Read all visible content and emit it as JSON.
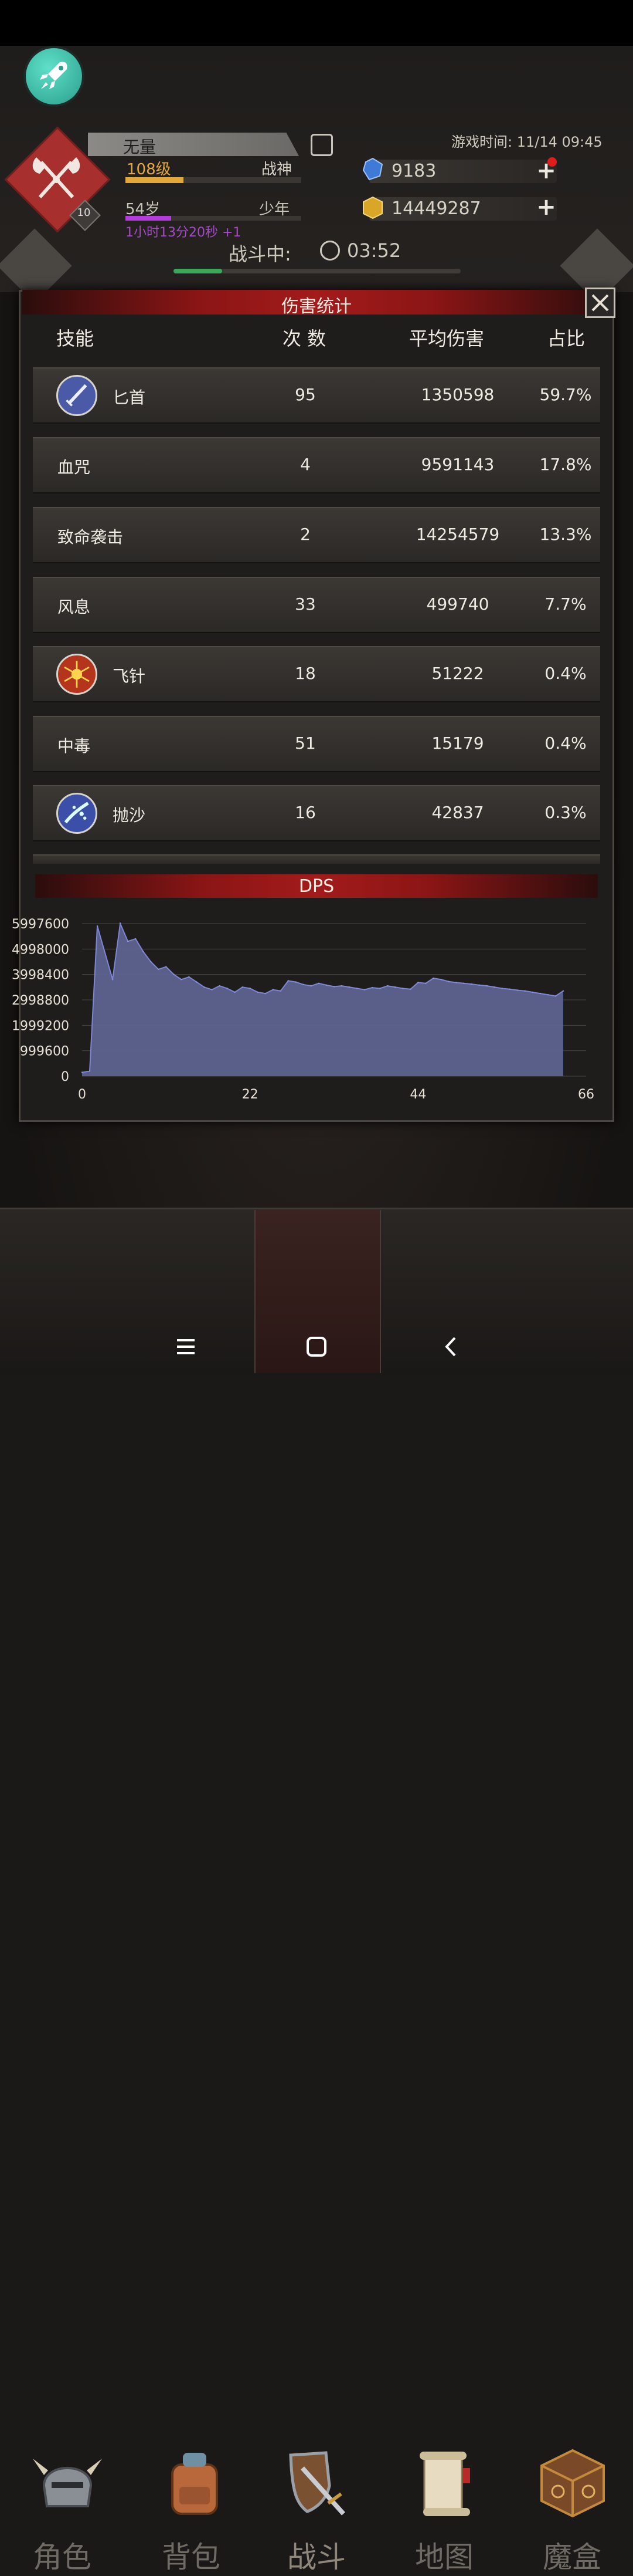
{
  "header": {
    "player_name": "无量",
    "level": "108级",
    "title": "战神",
    "age": "54岁",
    "stage": "少年",
    "time_bonus": "1小时13分20秒 +1",
    "rank_badge": "10",
    "game_time": "游戏时间: 11/14 09:45",
    "gems": "9183",
    "gold": "14449287",
    "level_progress": 0.33,
    "age_progress": 0.26
  },
  "battle": {
    "label": "战斗中:",
    "timer": "03:52",
    "progress": 0.17
  },
  "damage_panel": {
    "title": "伤害统计",
    "columns": {
      "skill": "技能",
      "count": "次 数",
      "avg": "平均伤害",
      "ratio": "占比"
    },
    "rows": [
      {
        "name": "匕首",
        "count": "95",
        "avg": "1350598",
        "ratio": "59.7%",
        "icon": "dagger-icon"
      },
      {
        "name": "血咒",
        "count": "4",
        "avg": "9591143",
        "ratio": "17.8%",
        "icon": ""
      },
      {
        "name": "致命袭击",
        "count": "2",
        "avg": "14254579",
        "ratio": "13.3%",
        "icon": ""
      },
      {
        "name": "风息",
        "count": "33",
        "avg": "499740",
        "ratio": "7.7%",
        "icon": ""
      },
      {
        "name": "飞针",
        "count": "18",
        "avg": "51222",
        "ratio": "0.4%",
        "icon": "needle-spider-icon"
      },
      {
        "name": "中毒",
        "count": "51",
        "avg": "15179",
        "ratio": "0.4%",
        "icon": ""
      },
      {
        "name": "抛沙",
        "count": "16",
        "avg": "42837",
        "ratio": "0.3%",
        "icon": "sand-throw-icon"
      }
    ]
  },
  "chart_data": {
    "type": "area",
    "title": "DPS",
    "xlabel": "",
    "ylabel": "",
    "xlim": [
      0,
      66
    ],
    "ylim": [
      0,
      5997600
    ],
    "x_ticks": [
      "0",
      "22",
      "44",
      "66"
    ],
    "y_ticks": [
      "5997600",
      "4998000",
      "3998400",
      "2998800",
      "1999200",
      "999600",
      "0"
    ],
    "grid": true,
    "series": [
      {
        "color": "#5d638f",
        "x": [
          0,
          1,
          2,
          4,
          5,
          6,
          7,
          8,
          9,
          10,
          11,
          12,
          13,
          14,
          15,
          16,
          17,
          18,
          19,
          20,
          21,
          22,
          23,
          24,
          25,
          26,
          27,
          28,
          29,
          30,
          31,
          32,
          33,
          34,
          35,
          36,
          37,
          38,
          39,
          40,
          41,
          42,
          43,
          44,
          45,
          46,
          47,
          48,
          49,
          50,
          51,
          52,
          53,
          54,
          55,
          56,
          57,
          58,
          59,
          60,
          61,
          62,
          63
        ],
        "y": [
          150000,
          200000,
          5900000,
          3800000,
          6000000,
          5300000,
          5400000,
          4900000,
          4500000,
          4200000,
          4300000,
          4000000,
          3800000,
          3900000,
          3700000,
          3500000,
          3400000,
          3550000,
          3450000,
          3300000,
          3500000,
          3450000,
          3300000,
          3250000,
          3400000,
          3350000,
          3750000,
          3700000,
          3600000,
          3550000,
          3650000,
          3580000,
          3520000,
          3550000,
          3500000,
          3450000,
          3400000,
          3480000,
          3450000,
          3550000,
          3500000,
          3450000,
          3420000,
          3680000,
          3650000,
          3850000,
          3800000,
          3720000,
          3680000,
          3650000,
          3620000,
          3580000,
          3550000,
          3500000,
          3450000,
          3420000,
          3380000,
          3350000,
          3300000,
          3250000,
          3200000,
          3150000,
          3350000
        ]
      }
    ]
  },
  "nav": {
    "items": [
      {
        "label": "角色",
        "icon": "helmet-icon"
      },
      {
        "label": "背包",
        "icon": "backpack-icon"
      },
      {
        "label": "战斗",
        "icon": "sword-shield-icon"
      },
      {
        "label": "地图",
        "icon": "scroll-map-icon"
      },
      {
        "label": "魔盒",
        "icon": "magic-box-icon"
      }
    ]
  }
}
